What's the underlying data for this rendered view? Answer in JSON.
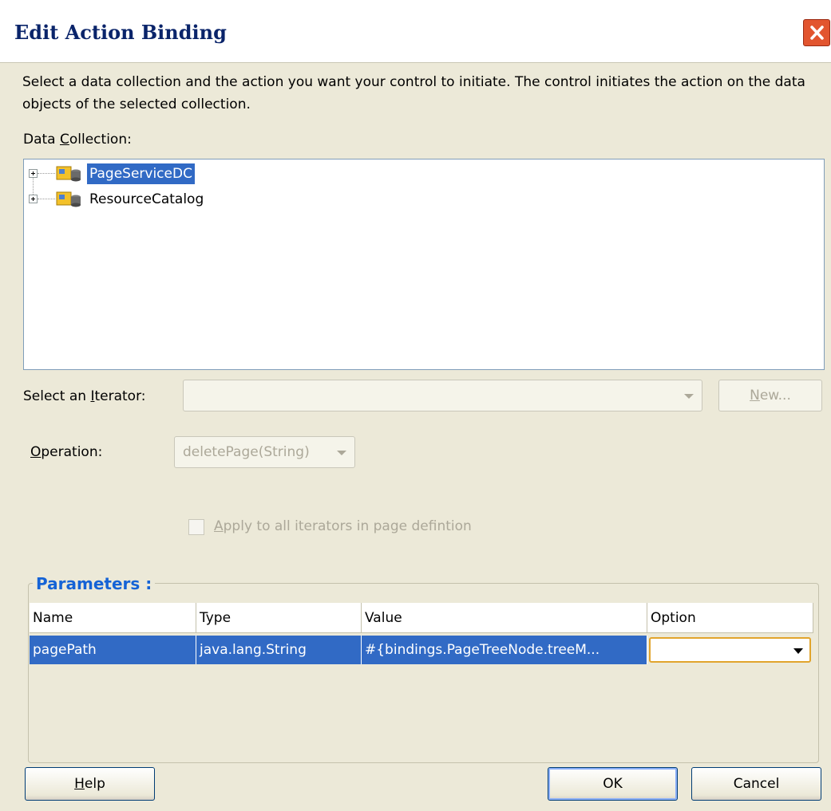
{
  "dialog": {
    "title": "Edit Action Binding"
  },
  "description": "Select a data collection and the action you want your control to initiate. The control initiates the action on the data objects of the selected collection.",
  "data_collection": {
    "label_pre": "Data ",
    "label_mnemonic": "C",
    "label_post": "ollection:",
    "items": [
      {
        "label": "PageServiceDC",
        "selected": true,
        "icon": "data-control-icon"
      },
      {
        "label": "ResourceCatalog",
        "selected": false,
        "icon": "data-control-icon"
      }
    ]
  },
  "iterator": {
    "label_pre": "Select an ",
    "label_mnemonic": "I",
    "label_post": "terator:",
    "value": "",
    "new_button_mnemonic": "N",
    "new_button_rest": "ew..."
  },
  "operation": {
    "label_mnemonic": "O",
    "label_post": "peration:",
    "value": "deletePage(String)"
  },
  "apply_all": {
    "label_mnemonic": "A",
    "label_post": "pply to all iterators in page defintion",
    "checked": false
  },
  "parameters": {
    "title": "Parameters :",
    "columns": [
      "Name",
      "Type",
      "Value",
      "Option"
    ],
    "rows": [
      {
        "name": "pagePath",
        "type": "java.lang.String",
        "value": "#{bindings.PageTreeNode.treeM...",
        "option": ""
      }
    ]
  },
  "buttons": {
    "help_mnemonic": "H",
    "help_rest": "elp",
    "ok": "OK",
    "cancel": "Cancel"
  },
  "colors": {
    "selection": "#316ac5",
    "group_title": "#1563d6",
    "title": "#0a246a"
  }
}
